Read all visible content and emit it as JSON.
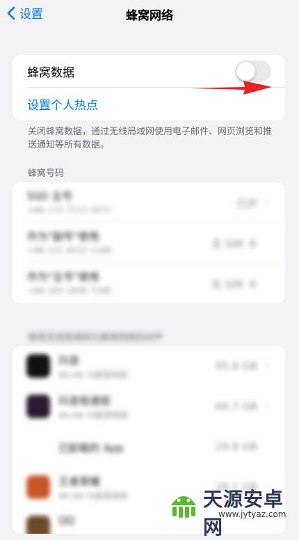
{
  "nav": {
    "back_label": "设置",
    "title": "蜂窝网络"
  },
  "cellular": {
    "label": "蜂窝数据",
    "enabled": false,
    "hotspot_label": "设置个人热点"
  },
  "footnote": "关闭蜂窝数据，通过无线局域网使用电子邮件、网页浏览和推送通知等所有数据。",
  "numbers_header": "蜂窝号码",
  "numbers": [
    {
      "name": "SSD 主号",
      "detail": "+86 173 7113 2872",
      "status": "已开"
    },
    {
      "name": "作为\"副号\"使用",
      "detail": "+86 151 6032 1168",
      "status": "无 SIM 卡"
    },
    {
      "name": "作为\"主号\"使用",
      "detail": "+86 183 1808 7288",
      "status": "无 SIM 卡"
    }
  ],
  "apps_header": "使用无线局域网与蜂窝网络的APP",
  "apps": [
    {
      "name": "抖音",
      "detail": "WLAN 与蜂窝网络",
      "usage": "95.8 GB"
    },
    {
      "name": "抖音极速版",
      "detail": "WLAN 与蜂窝网络",
      "usage": "64.7 GB"
    },
    {
      "name": "已卸载的 App",
      "detail": "",
      "usage": "29.8 GB"
    },
    {
      "name": "王者荣耀",
      "detail": "WLAN 与蜂窝网络",
      "usage": "28.1 GB"
    },
    {
      "name": "QQ",
      "detail": "",
      "usage": ""
    }
  ],
  "watermark": {
    "brand": "天源安卓网",
    "url": "www.jytyaz.com"
  },
  "colors": {
    "accent": "#007aff",
    "arrow": "#e8201f",
    "background": "#f2f2f7"
  }
}
